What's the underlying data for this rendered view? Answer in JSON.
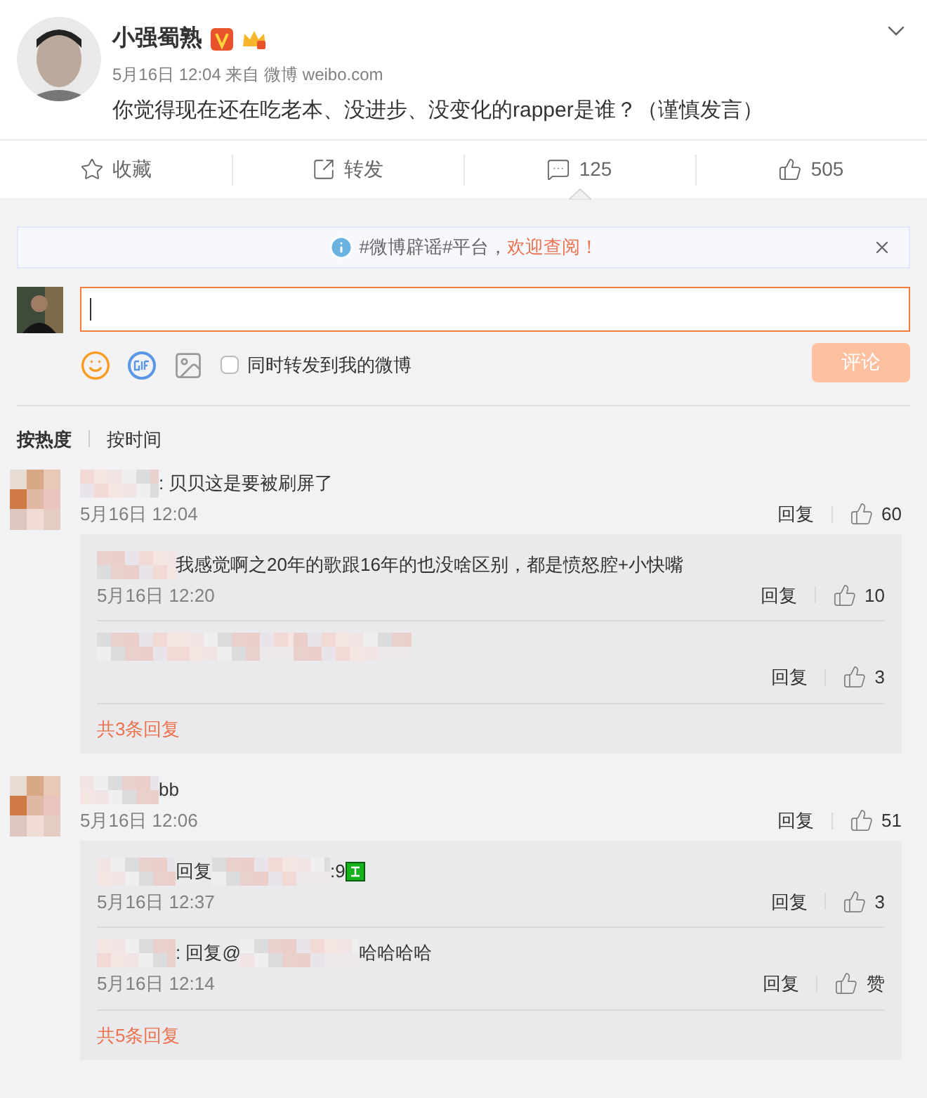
{
  "post": {
    "author": "小强蜀熟",
    "time": "5月16日 12:04",
    "source": "来自 微博 weibo.com",
    "text": "你觉得现在还在吃老本、没进步、没变化的rapper是谁？（谨慎发言）"
  },
  "actions": [
    {
      "kind": "star",
      "label": "收藏",
      "selected": false
    },
    {
      "kind": "share",
      "label": "转发",
      "selected": false
    },
    {
      "kind": "comment",
      "label": "125",
      "selected": true
    },
    {
      "kind": "like",
      "label": "505",
      "selected": false
    }
  ],
  "notice": {
    "text": "#微博辟谣#平台，",
    "link": "欢迎查阅！"
  },
  "composer": {
    "repost_label": "同时转发到我的微博",
    "repost_checked": false,
    "submit": "评论",
    "submit_disabled": true
  },
  "sort_tabs": [
    {
      "label": "按热度",
      "selected": true
    },
    {
      "label": "按时间",
      "selected": false
    }
  ],
  "comments": [
    {
      "segments": [
        {
          "kind": "blur"
        },
        {
          "kind": "text",
          "text": ": 贝贝这是要被刷屏了"
        }
      ],
      "time": "5月16日 12:04",
      "reply": "回复",
      "likes": "60",
      "replies": [
        {
          "segments": [
            {
              "kind": "blur"
            },
            {
              "kind": "text",
              "text": "我感觉啊之20年的歌跟16年的也没啥区别，都是愤怒腔+小快嘴"
            }
          ],
          "time": "5月16日 12:20",
          "reply": "回复",
          "likes": "10"
        },
        {
          "segments": [
            {
              "kind": "blur"
            },
            {
              "kind": "blur"
            },
            {
              "kind": "blur"
            }
          ],
          "reply": "回复",
          "likes": "3"
        }
      ],
      "more": "共3条回复"
    },
    {
      "segments": [
        {
          "kind": "blur"
        },
        {
          "kind": "text",
          "text": "bb"
        }
      ],
      "time": "5月16日 12:06",
      "reply": "回复",
      "likes": "51",
      "replies": [
        {
          "segments": [
            {
              "kind": "blur"
            },
            {
              "kind": "text",
              "text": "回复"
            },
            {
              "kind": "blur"
            },
            {
              "kind": "text",
              "text": ":9"
            },
            {
              "kind": "emoji"
            }
          ],
          "time": "5月16日 12:37",
          "reply": "回复",
          "likes": "3"
        },
        {
          "segments": [
            {
              "kind": "blur"
            },
            {
              "kind": "text",
              "text": ": 回复@"
            },
            {
              "kind": "blur"
            },
            {
              "kind": "text",
              "text": "哈哈哈哈"
            }
          ],
          "time": "5月16日 12:14",
          "reply": "回复",
          "likes": "赞"
        }
      ],
      "more": "共5条回复"
    }
  ]
}
